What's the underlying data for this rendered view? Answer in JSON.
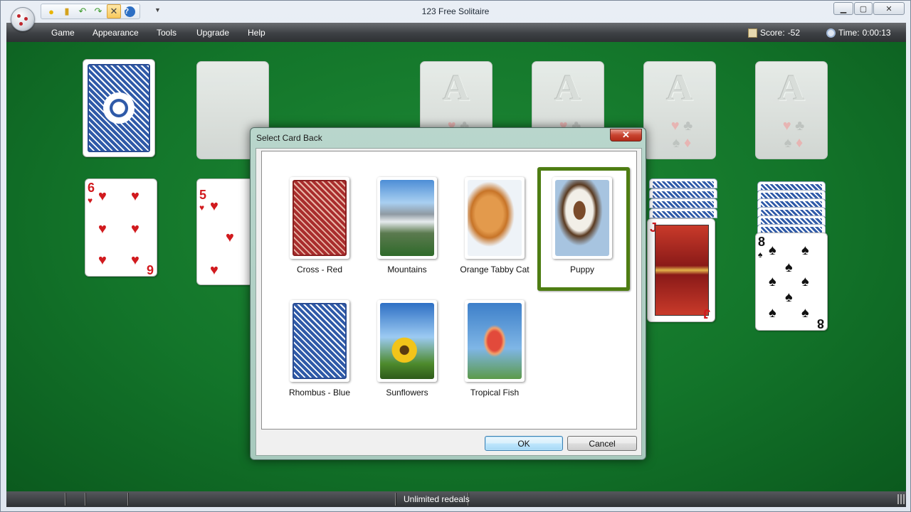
{
  "window": {
    "title": "123 Free Solitaire"
  },
  "quickbar": {
    "icons": [
      "new-game-icon",
      "deck-icon",
      "undo-icon",
      "redo-icon",
      "hint-icon",
      "help-icon"
    ]
  },
  "menu": {
    "items": [
      "Game",
      "Appearance",
      "Tools",
      "Upgrade",
      "Help"
    ]
  },
  "stats": {
    "score_label": "Score:",
    "score_value": "-52",
    "time_label": "Time:",
    "time_value": "0:00:13"
  },
  "table": {
    "foundation_ace": "A",
    "tableau": {
      "col1_rank": "6",
      "col2_rank": "5",
      "col5_rank": "J",
      "col6_rank": "8"
    }
  },
  "dialog": {
    "title": "Select Card Back",
    "close_label": "✕",
    "options": [
      {
        "label": "Cross - Red",
        "selected": false
      },
      {
        "label": "Mountains",
        "selected": false
      },
      {
        "label": "Orange Tabby Cat",
        "selected": false
      },
      {
        "label": "Puppy",
        "selected": true
      },
      {
        "label": "Rhombus - Blue",
        "selected": false
      },
      {
        "label": "Sunflowers",
        "selected": false
      },
      {
        "label": "Tropical Fish",
        "selected": false
      }
    ],
    "ok_label": "OK",
    "cancel_label": "Cancel"
  },
  "status": {
    "text": "Unlimited redeals"
  },
  "colors": {
    "felt": "#13752a",
    "selection": "#4e7d13",
    "red_suit": "#d11a1e"
  }
}
